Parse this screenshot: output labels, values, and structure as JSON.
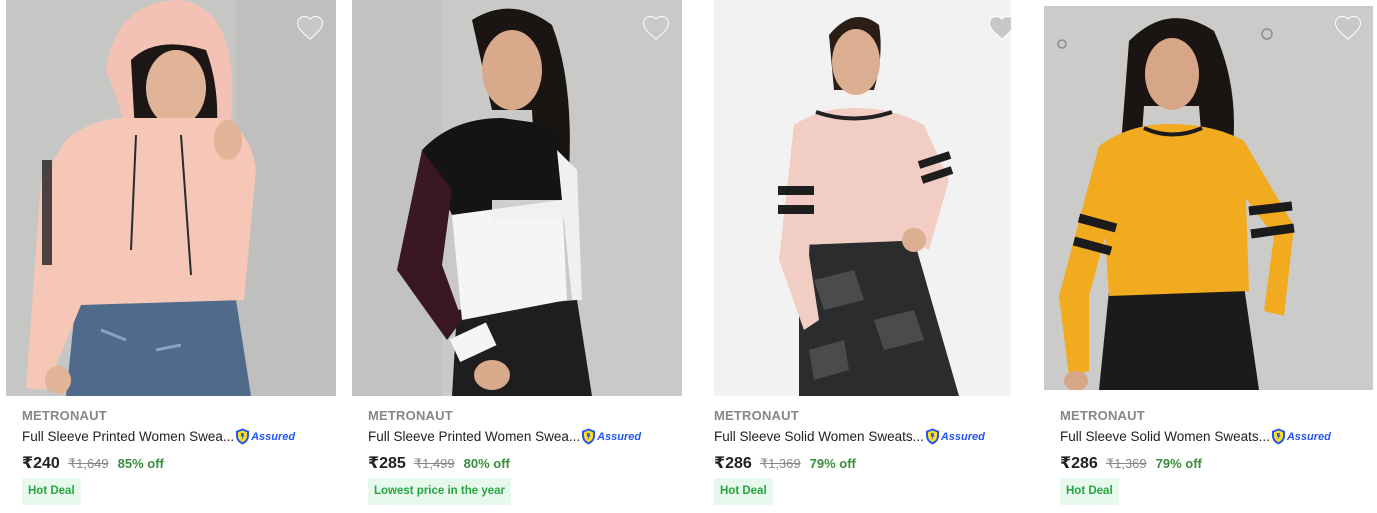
{
  "products": [
    {
      "brand": "METRONAUT",
      "title": "Full Sleeve Printed Women Swea...",
      "assured": "Assured",
      "price": "₹240",
      "mrp": "₹1,649",
      "discount": "85% off",
      "badge": "Hot Deal",
      "image": "woman-peach-hoodie-photo",
      "wishlist_icon": "heart-icon"
    },
    {
      "brand": "METRONAUT",
      "title": "Full Sleeve Printed Women Swea...",
      "assured": "Assured",
      "price": "₹285",
      "mrp": "₹1,499",
      "discount": "80% off",
      "badge": "Lowest price in the year",
      "image": "woman-black-white-revolution-sweatshirt-photo",
      "wishlist_icon": "heart-icon"
    },
    {
      "brand": "METRONAUT",
      "title": "Full Sleeve Solid Women Sweats...",
      "assured": "Assured",
      "price": "₹286",
      "mrp": "₹1,369",
      "discount": "79% off",
      "badge": "Hot Deal",
      "image": "woman-pink-striped-crop-sweatshirt-photo",
      "wishlist_icon": "heart-icon"
    },
    {
      "brand": "METRONAUT",
      "title": "Full Sleeve Solid Women Sweats...",
      "assured": "Assured",
      "price": "₹286",
      "mrp": "₹1,369",
      "discount": "79% off",
      "badge": "Hot Deal",
      "image": "woman-yellow-striped-crop-sweatshirt-photo",
      "wishlist_icon": "heart-icon"
    }
  ],
  "colors": {
    "brand_gray": "#878787",
    "discount_green": "#388e3c",
    "deal_bg": "#e7f8ec",
    "deal_text": "#26a541",
    "assured_blue": "#2455f4"
  }
}
